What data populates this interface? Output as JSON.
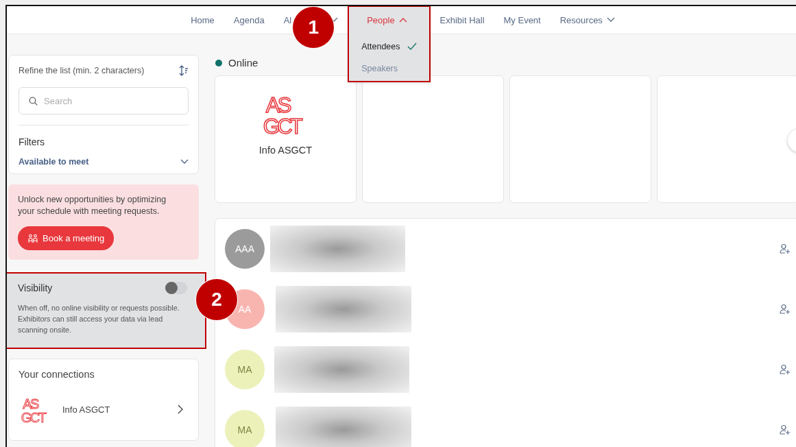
{
  "nav": {
    "items": [
      {
        "label": "Home",
        "dropdown": false,
        "open": false
      },
      {
        "label": "Agenda",
        "dropdown": false,
        "open": false
      },
      {
        "label": "Al",
        "dropdown": true,
        "open": false
      },
      {
        "label": "People",
        "dropdown": true,
        "open": true
      },
      {
        "label": "Exhibit Hall",
        "dropdown": false,
        "open": false
      },
      {
        "label": "My Event",
        "dropdown": false,
        "open": false
      },
      {
        "label": "Resources",
        "dropdown": true,
        "open": false
      }
    ]
  },
  "people_menu": {
    "items": [
      {
        "label": "Attendees",
        "selected": true
      },
      {
        "label": "Speakers",
        "selected": false
      }
    ]
  },
  "sidebar": {
    "refine": {
      "label": "Refine the list (min. 2 characters)",
      "placeholder": "Search",
      "filters_title": "Filters",
      "filter": "Available to meet"
    },
    "promo": {
      "text": "Unlock new opportunities by optimizing your schedule with meeting requests.",
      "button": "Book a meeting"
    },
    "visibility": {
      "title": "Visibility",
      "on": false,
      "description": "When off, no online visibility or requests possible. Exhibitors can still access your data via lead scanning onsite."
    },
    "connections": {
      "title": "Your connections",
      "items": [
        {
          "logo": [
            "AS",
            "GCT"
          ],
          "name": "Info ASGCT"
        }
      ]
    }
  },
  "online": {
    "label": "Online",
    "cards": [
      {
        "kind": "organizer",
        "logo": [
          "AS",
          "GCT"
        ],
        "name": "Info ASGCT"
      },
      {
        "kind": "blank"
      },
      {
        "kind": "blank"
      },
      {
        "kind": "blank"
      }
    ]
  },
  "attendees": [
    {
      "initials": "AAA",
      "color": "#9b9b9b"
    },
    {
      "initials": "AA",
      "color": "#f8b5b0"
    },
    {
      "initials": "MA",
      "color": "#ebf1b9"
    },
    {
      "initials": "MA",
      "color": "#ebf1b9"
    }
  ],
  "annotations": [
    {
      "number": "1"
    },
    {
      "number": "2"
    }
  ]
}
